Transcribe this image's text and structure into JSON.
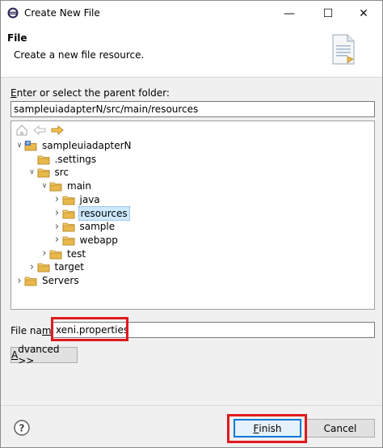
{
  "window": {
    "title": "Create New File",
    "minimize_glyph": "—",
    "maximize_glyph": "☐",
    "close_glyph": "✕"
  },
  "banner": {
    "title": "File",
    "description": "Create a new file resource."
  },
  "parent_folder": {
    "label_mnemonic": "E",
    "label_rest": "nter or select the parent folder:",
    "value": "sampleuiadapterN/src/main/resources"
  },
  "tree": {
    "toolbar": [
      "home-icon",
      "back-arrow-icon",
      "forward-arrow-icon"
    ],
    "nodes": [
      {
        "label": "sampleuiadapterN",
        "expanded": true,
        "icon": "project-icon"
      },
      {
        "label": ".settings",
        "expanded": null,
        "icon": "folder-icon"
      },
      {
        "label": "src",
        "expanded": true,
        "icon": "folder-icon"
      },
      {
        "label": "main",
        "expanded": true,
        "icon": "folder-icon"
      },
      {
        "label": "java",
        "expanded": false,
        "icon": "folder-icon"
      },
      {
        "label": "resources",
        "expanded": false,
        "icon": "folder-icon",
        "selected": true
      },
      {
        "label": "sample",
        "expanded": false,
        "icon": "folder-icon"
      },
      {
        "label": "webapp",
        "expanded": false,
        "icon": "folder-icon"
      },
      {
        "label": "test",
        "expanded": false,
        "icon": "folder-icon"
      },
      {
        "label": "target",
        "expanded": false,
        "icon": "folder-icon"
      },
      {
        "label": "Servers",
        "expanded": false,
        "icon": "folder-icon"
      }
    ]
  },
  "file_name": {
    "label_pre": "File na",
    "label_mnemonic": "m",
    "label_post": "e:",
    "value": "xeni.properties"
  },
  "buttons": {
    "advanced_mnemonic": "A",
    "advanced_rest": "dvanced >>",
    "finish_mnemonic": "F",
    "finish_rest": "inish",
    "cancel": "Cancel",
    "help_glyph": "?"
  },
  "colors": {
    "highlight": "#e0191d",
    "selection": "#cce8ff",
    "default_button_border": "#0078d7",
    "folder": "#e8b84a"
  }
}
